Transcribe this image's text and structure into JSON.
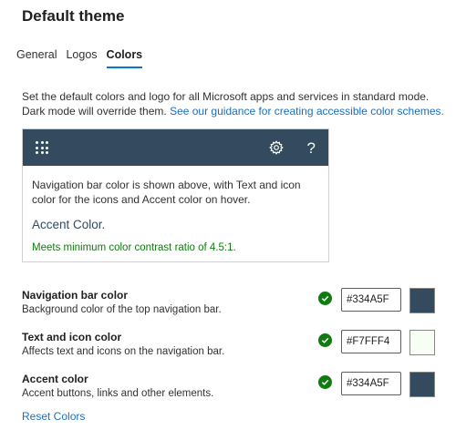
{
  "page": {
    "title": "Default theme"
  },
  "tabs": [
    {
      "label": "General"
    },
    {
      "label": "Logos"
    },
    {
      "label": "Colors"
    }
  ],
  "active_tab": "Colors",
  "description": {
    "text": "Set the default colors and logo for all Microsoft apps and services in standard mode. Dark mode will override them. ",
    "link": "See our guidance for creating accessible color schemes."
  },
  "preview": {
    "nav_color": "#334A5F",
    "icon_color": "#F7FFF4",
    "accent_color": "#334A5F",
    "icons": [
      "waffle-icon",
      "gear-icon",
      "question-icon"
    ],
    "help_glyph": "?",
    "text": "Navigation bar color is shown above, with Text and icon color for the icons and Accent color on hover.",
    "accent_label": "Accent Color.",
    "contrast_message": "Meets minimum color contrast ratio of 4.5:1.",
    "contrast_color": "#107C10"
  },
  "settings": [
    {
      "name": "Navigation bar color",
      "description": "Background color of the top navigation bar.",
      "value": "#334A5F",
      "valid": true
    },
    {
      "name": "Text and icon color",
      "description": "Affects text and icons on the navigation bar.",
      "value": "#F7FFF4",
      "valid": true
    },
    {
      "name": "Accent color",
      "description": "Accent buttons, links and other elements.",
      "value": "#334A5F",
      "valid": true
    }
  ],
  "reset_label": "Reset Colors"
}
